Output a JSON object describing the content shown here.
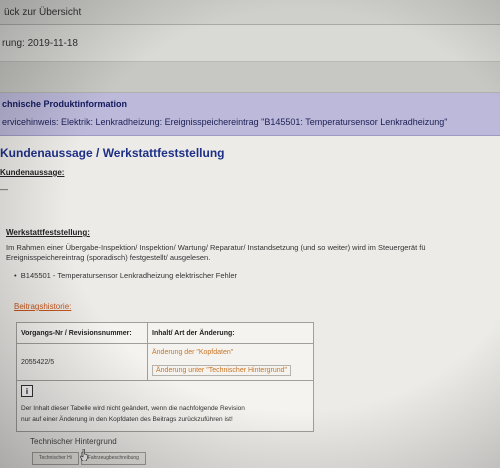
{
  "nav": {
    "back_label": "ück zur Übersicht"
  },
  "release": {
    "text": "rung:  2019-11-18"
  },
  "tpi": {
    "title": "chnische Produktinformation",
    "service_note": "ervicehinweis: Elektrik: Lenkradheizung: Ereignisspeichereintrag \"B145501: Temperatursensor Lenkradheizung\""
  },
  "section": {
    "title": "Kundenaussage / Werkstattfeststellung",
    "customer_heading": "Kundenaussage:",
    "customer_value": "—",
    "workshop_heading": "Werkstattfeststellung:",
    "workshop_line1": "Im Rahmen einer Übergabe-Inspektion/ Inspektion/ Wartung/ Reparatur/ Instandsetzung (und so weiter) wird im Steuergerät fü",
    "workshop_line2": "Ereignisspeichereintrag (sporadisch) festgestellt/ ausgelesen.",
    "workshop_item": "B145501 - Temperatursensor Lenkradheizung elektrischer Fehler"
  },
  "history": {
    "heading": "Beitragshistorie:",
    "col1": "Vorgangs-Nr / Revisionsnummer:",
    "col2": "Inhalt/ Art der Änderung:",
    "rows": [
      {
        "number": "2055422/5",
        "changes": [
          "Änderung der \"Kopfdaten\"",
          "Änderung unter \"Technischer Hintergrund\""
        ]
      }
    ],
    "note_icon": "i",
    "note_line1": "Der Inhalt dieser Tabelle wird nicht geändert, wenn die nachfolgende Revision",
    "note_line2": "nur auf einer Änderung in den Kopfdaten des Beitrags zurückzuführen ist!"
  },
  "footer": {
    "tech_background": "Technischer Hintergrund",
    "tabs": [
      "Technischer Hi",
      "Fahrzeugbeschreibung"
    ]
  }
}
